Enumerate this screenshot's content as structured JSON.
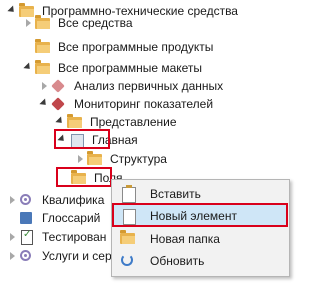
{
  "tree": {
    "items": [
      {
        "label": "Программно-технические средства"
      },
      {
        "label": "Все средства"
      },
      {
        "label": "Все программные продукты"
      },
      {
        "label": "Все программные макеты"
      },
      {
        "label": "Анализ первичных данных"
      },
      {
        "label": "Мониторинг показателей"
      },
      {
        "label": "Представление"
      },
      {
        "label": "Главная"
      },
      {
        "label": "Структура"
      },
      {
        "label": "Поля"
      },
      {
        "label": "Квалифика"
      },
      {
        "label": "Глоссарий"
      },
      {
        "label": "Тестирован"
      },
      {
        "label": "Услуги и сер"
      }
    ]
  },
  "context_menu": {
    "items": [
      {
        "label": "Вставить"
      },
      {
        "label": "Новый элемент"
      },
      {
        "label": "Новая папка"
      },
      {
        "label": "Обновить"
      }
    ],
    "highlighted_index": 1
  },
  "colors": {
    "highlight_border": "#d9001b",
    "menu_hover": "#cfe6f7",
    "folder": "#e8b24c"
  }
}
